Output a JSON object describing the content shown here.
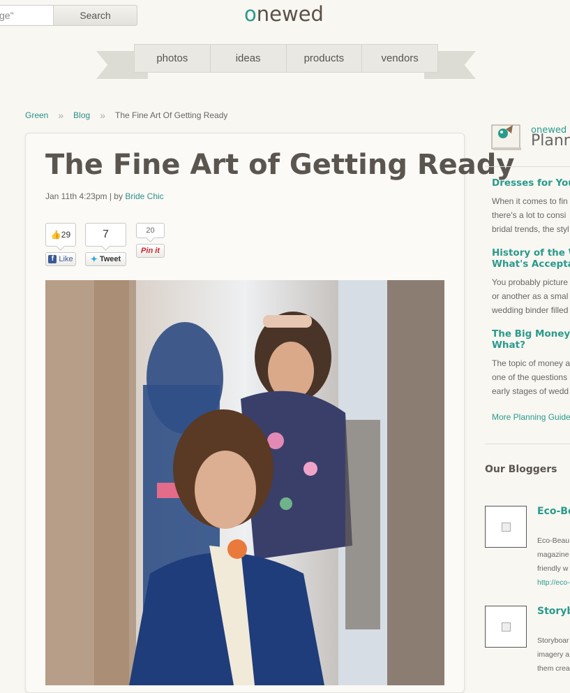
{
  "search": {
    "value": "ge\"",
    "button": "Search"
  },
  "logo": {
    "first": "o",
    "rest": "newed"
  },
  "nav": [
    "photos",
    "ideas",
    "products",
    "vendors"
  ],
  "breadcrumb": [
    "Green",
    "»",
    "Blog",
    "»",
    "The Fine Art Of Getting Ready"
  ],
  "article": {
    "title": "The Fine Art of Getting Ready",
    "date": "Jan 11th 4:23pm | by ",
    "author": "Bride Chic",
    "fb_count": "29",
    "fb_label": "Like",
    "tweet_count": "7",
    "tweet_label": "Tweet",
    "pin_count": "20",
    "pin_label": "Pin it"
  },
  "sidebar": {
    "brand": "onewed",
    "planner": "Plann",
    "guides": [
      {
        "title": "Dresses for Your",
        "text": [
          "When it comes to fin",
          "there's a lot to consi",
          "bridal trends, the styl"
        ]
      },
      {
        "title": "History of the W",
        "title2": "What's Acceptab",
        "text": [
          "You probably picture",
          "or another as a smal",
          "wedding binder filled"
        ]
      },
      {
        "title": "The Big Money Q",
        "title2": "What?",
        "text": [
          "The topic of money a",
          "one of the questions",
          "early stages of wedd"
        ]
      }
    ],
    "more_guides": "More Planning Guide",
    "bloggers_title": "Our Bloggers",
    "bloggers": [
      {
        "name": "Eco-Be",
        "desc": [
          "Eco-Beau",
          "magazine",
          "friendly w"
        ],
        "link": "http://eco-"
      },
      {
        "name": "Storyb",
        "desc": [
          "Storyboar",
          "imagery a",
          "them crea"
        ]
      }
    ]
  }
}
